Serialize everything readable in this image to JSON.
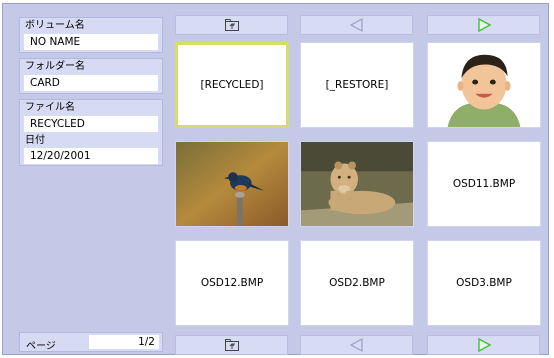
{
  "info_panel": {
    "volume_label": "ボリューム名",
    "volume_value": "NO NAME",
    "folder_label": "フォルダー名",
    "folder_value": "CARD",
    "file_label": "ファイル名",
    "file_value": "RECYCLED",
    "date_label": "日付",
    "date_value": "12/20/2001"
  },
  "paging": {
    "label": "ページ",
    "value": "1/2"
  },
  "nav_icons": {
    "parent": "folder-up-icon",
    "prev": "triangle-left-icon",
    "next": "triangle-right-icon"
  },
  "grid": {
    "items": [
      {
        "label": "[RECYCLED]",
        "kind": "folder",
        "selected": true
      },
      {
        "label": "[_RESTORE]",
        "kind": "folder",
        "selected": false
      },
      {
        "label": "",
        "kind": "photo-child",
        "selected": false
      },
      {
        "label": "",
        "kind": "photo-bird",
        "selected": false
      },
      {
        "label": "",
        "kind": "photo-lion",
        "selected": false
      },
      {
        "label": "OSD11.BMP",
        "kind": "file",
        "selected": false
      },
      {
        "label": "OSD12.BMP",
        "kind": "file",
        "selected": false
      },
      {
        "label": "OSD2.BMP",
        "kind": "file",
        "selected": false
      },
      {
        "label": "OSD3.BMP",
        "kind": "file",
        "selected": false
      }
    ]
  },
  "colors": {
    "background": "#c4c9e8",
    "panel": "#d6daf2",
    "selection_border": "#d7dc6a",
    "next_arrow": "#3fbf3f",
    "prev_arrow": "#9aa0c8"
  }
}
